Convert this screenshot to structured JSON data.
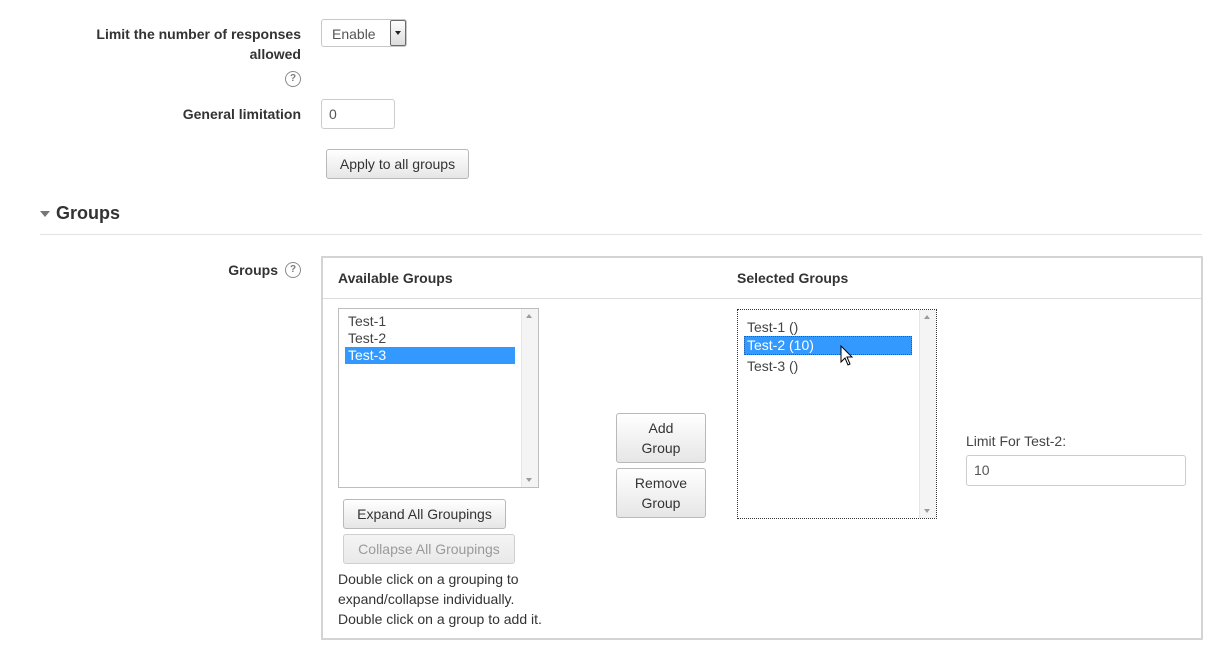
{
  "limit_responses": {
    "label_line1": "Limit the number of responses",
    "label_line2": "allowed",
    "select_value": "Enable",
    "help_icon": "help-question-icon"
  },
  "general_limitation": {
    "label": "General limitation",
    "value": "0"
  },
  "apply_button": {
    "label": "Apply to all groups"
  },
  "groups_section": {
    "title": "Groups",
    "field_label": "Groups",
    "help_icon": "help-question-icon",
    "available": {
      "heading": "Available Groups",
      "items": [
        "Test-1",
        "Test-2",
        "Test-3"
      ],
      "selected_item": "Test-3"
    },
    "selected": {
      "heading": "Selected Groups",
      "items": [
        "Test-1 ()",
        "Test-2 (10)",
        "Test-3 ()"
      ],
      "selected_item": "Test-2 (10)"
    },
    "add_button": {
      "line1": "Add",
      "line2": "Group"
    },
    "remove_button": {
      "line1": "Remove",
      "line2": "Group"
    },
    "expand_button": {
      "label": "Expand All Groupings"
    },
    "collapse_button": {
      "label": "Collapse All Groupings"
    },
    "help_text": {
      "line1": "Double click on a grouping to",
      "line2": "expand/collapse individually.",
      "line3": "Double click on a group to add it."
    },
    "limit_for": {
      "label": "Limit For Test-2:",
      "value": "10"
    }
  },
  "colors": {
    "selection": "#3399ff",
    "panel_border": "#d4d4d4"
  }
}
